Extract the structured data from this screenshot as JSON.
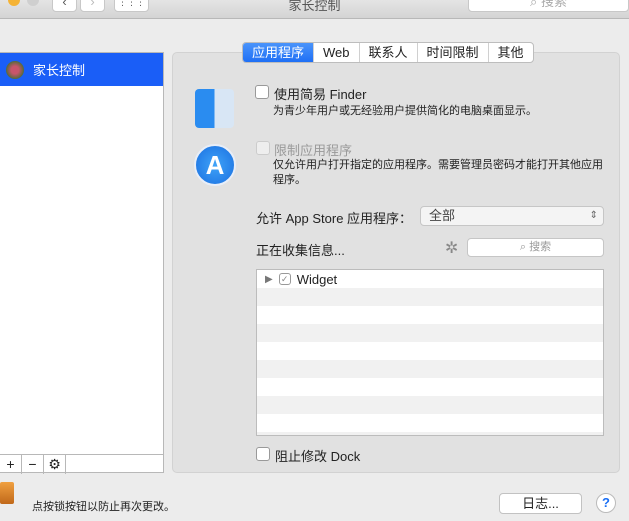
{
  "window": {
    "title": "家长控制",
    "search_placeholder": "搜索",
    "back": "‹",
    "forward": "›",
    "grid": "⋮⋮⋮"
  },
  "sidebar": {
    "items": [
      {
        "label": "家长控制",
        "selected": true
      }
    ],
    "add": "+",
    "remove": "−",
    "gear": "⚙"
  },
  "tabs": [
    {
      "label": "应用程序",
      "active": true
    },
    {
      "label": "Web"
    },
    {
      "label": "联系人"
    },
    {
      "label": "时间限制"
    },
    {
      "label": "其他"
    }
  ],
  "simple_finder": {
    "label": "使用简易 Finder",
    "desc": "为青少年用户或无经验用户提供简化的电脑桌面显示。",
    "checked": false
  },
  "limit_apps": {
    "label": "限制应用程序",
    "desc": "仅允许用户打开指定的应用程序。需要管理员密码才能打开其他应用程序。",
    "checked": false,
    "enabled": false
  },
  "appstore": {
    "label": "允许 App Store 应用程序：",
    "value": "全部"
  },
  "collecting": {
    "label": "正在收集信息...",
    "search_placeholder": "搜索"
  },
  "app_list": [
    {
      "name": "Widget",
      "checked": true
    }
  ],
  "dock": {
    "label": "阻止修改 Dock",
    "checked": false
  },
  "footer": {
    "lock_text": "点按锁按钮以防止再次更改。",
    "log_button": "日志...",
    "help": "?"
  },
  "colors": {
    "accent": "#1a5ef7"
  }
}
